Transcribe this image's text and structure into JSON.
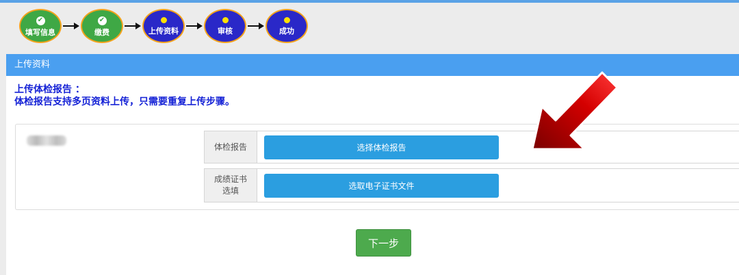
{
  "steps": [
    {
      "label": "填写信息",
      "status": "done",
      "icon": "check-icon"
    },
    {
      "label": "缴费",
      "status": "done",
      "icon": "check-icon"
    },
    {
      "label": "上传资料",
      "status": "current",
      "icon": "dot-icon"
    },
    {
      "label": "审核",
      "status": "pending",
      "icon": "dot-icon"
    },
    {
      "label": "成功",
      "status": "pending",
      "icon": "dot-icon"
    }
  ],
  "panel": {
    "title": "上传资料",
    "notice_line1": "上传体检报告 ：",
    "notice_line2": "体检报告支持多页资料上传，只需要重复上传步骤。"
  },
  "upload_rows": [
    {
      "label": "体检报告",
      "button": "选择体检报告"
    },
    {
      "label": "成绩证书选填",
      "label_line1": "成绩证书",
      "label_line2": "选填",
      "button": "选取电子证书文件"
    }
  ],
  "next_button": "下一步",
  "colors": {
    "header_blue": "#4a9ff0",
    "step_done": "#3fa845",
    "step_todo": "#2a28c8",
    "step_border": "#f3a31c",
    "button_blue": "#2b9ee0",
    "next_green": "#4daa4d",
    "notice_blue": "#1522d6",
    "arrow_red": "#d40000"
  }
}
